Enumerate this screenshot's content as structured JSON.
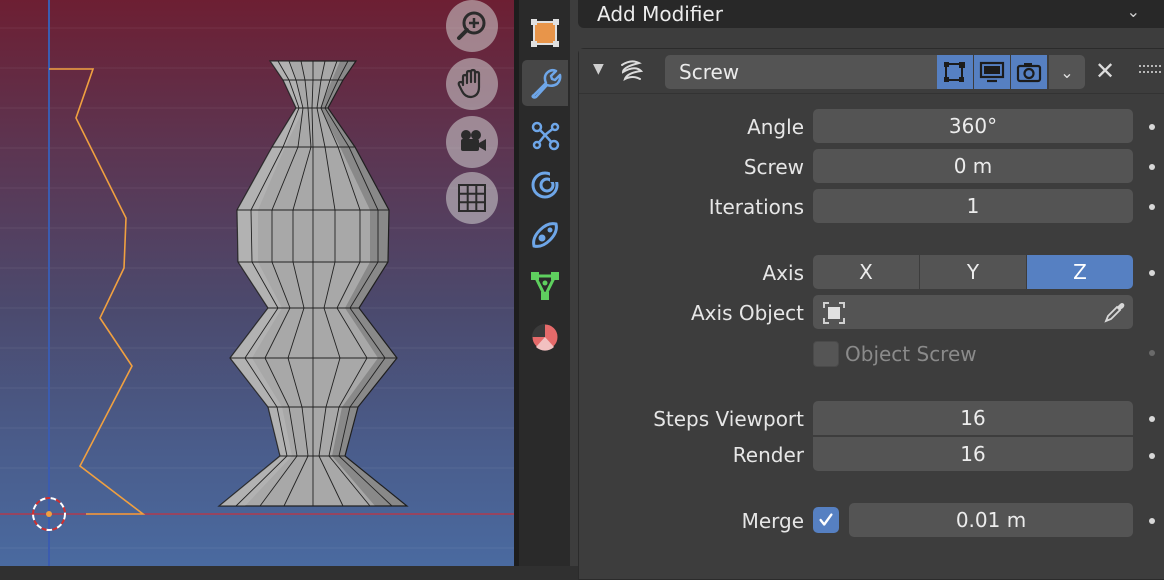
{
  "properties": {
    "add_modifier_label": "Add Modifier",
    "modifier": {
      "name": "Screw",
      "fields": {
        "angle_label": "Angle",
        "angle_value": "360°",
        "screw_label": "Screw",
        "screw_value": "0 m",
        "iterations_label": "Iterations",
        "iterations_value": "1",
        "axis_label": "Axis",
        "axis_options": [
          "X",
          "Y",
          "Z"
        ],
        "axis_selected": "Z",
        "axis_object_label": "Axis Object",
        "object_screw_label": "Object Screw",
        "object_screw_checked": false,
        "steps_viewport_label": "Steps Viewport",
        "steps_viewport_value": "16",
        "render_label": "Render",
        "render_value": "16",
        "merge_label": "Merge",
        "merge_checked": true,
        "merge_value": "0.01 m"
      }
    }
  },
  "tabs": [
    {
      "name": "object-data",
      "icon": "object-icon"
    },
    {
      "name": "modifiers",
      "icon": "wrench-icon",
      "active": true
    },
    {
      "name": "particles",
      "icon": "particles-icon"
    },
    {
      "name": "physics",
      "icon": "physics-icon"
    },
    {
      "name": "constraints",
      "icon": "constraints-icon"
    },
    {
      "name": "mesh-data",
      "icon": "mesh-data-icon"
    },
    {
      "name": "material",
      "icon": "material-icon"
    }
  ],
  "colors": {
    "accent": "#5680c2",
    "curve": "#f0a040",
    "viewport_top": "#6d1f33",
    "viewport_bottom": "#4a6aa0"
  }
}
